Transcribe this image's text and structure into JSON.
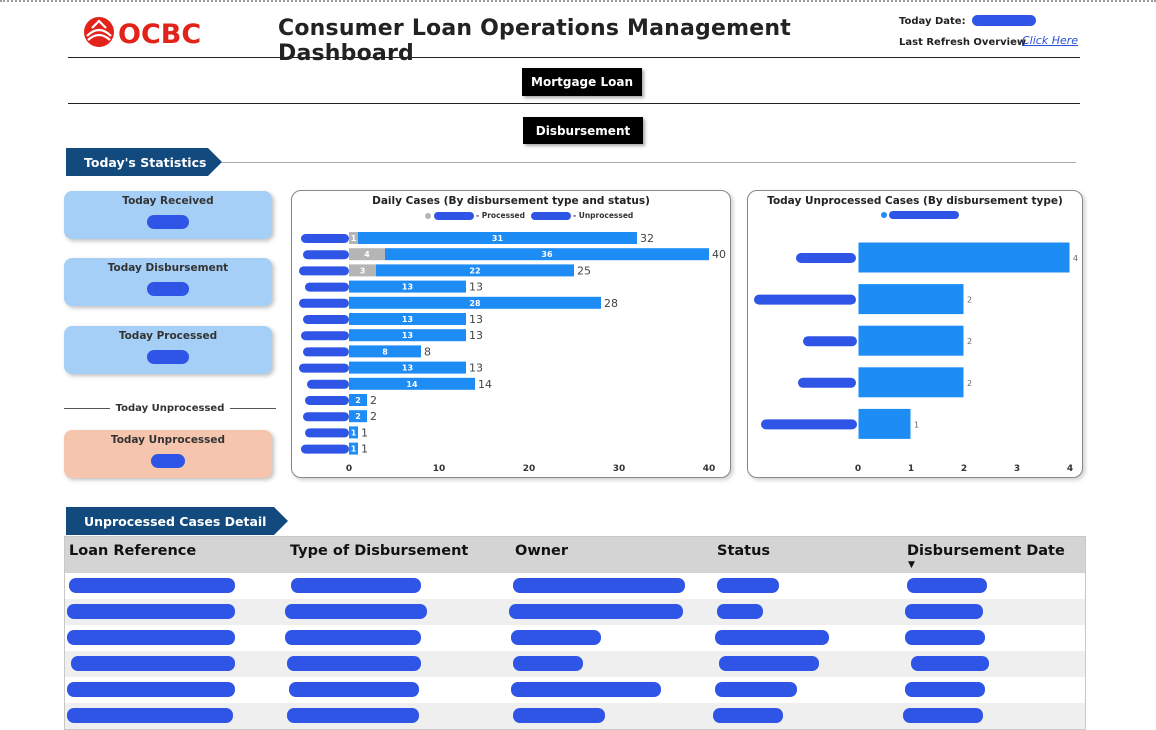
{
  "header": {
    "logo_text": "OCBC",
    "title": "Consumer Loan Operations Management Dashboard",
    "today_date_label": "Today Date:",
    "last_refresh_label": "Last Refresh Overview",
    "click_here_label": "Click Here"
  },
  "nav": {
    "mortgage_button": "Mortgage Loan",
    "disbursement_button": "Disbursement"
  },
  "stats_section": {
    "title": "Today's Statistics",
    "cards": [
      {
        "title": "Today Received"
      },
      {
        "title": "Today Disbursement"
      },
      {
        "title": "Today Processed"
      }
    ],
    "unprocessed_divider": "Today Unprocessed",
    "unprocessed_card": {
      "title": "Today Unprocessed"
    }
  },
  "colors": {
    "processed": "#b5b5b5",
    "unprocessed": "#1e8cf5",
    "banner": "#124a7d",
    "card_blue": "#a5cff7",
    "card_salmon": "#f5c5ae",
    "redaction": "#2f55e6"
  },
  "chart_data": [
    {
      "type": "bar",
      "orientation": "horizontal",
      "stacked": true,
      "title": "Daily Cases (By disbursement type and status)",
      "legend": {
        "placement": "top",
        "processed_label": "Processed",
        "unprocessed_label": "Unprocessed"
      },
      "xlim": [
        0,
        40
      ],
      "xticks": [
        "0",
        "10",
        "20",
        "30",
        "40"
      ],
      "series": [
        {
          "name": "Processed",
          "values": [
            1,
            4,
            3,
            0,
            0,
            0,
            0,
            0,
            0,
            0,
            0,
            0,
            0,
            0
          ]
        },
        {
          "name": "Unprocessed",
          "values": [
            31,
            36,
            22,
            13,
            28,
            13,
            13,
            8,
            13,
            14,
            2,
            2,
            1,
            1
          ]
        }
      ],
      "totals": [
        32,
        40,
        25,
        13,
        28,
        13,
        13,
        8,
        13,
        14,
        2,
        2,
        1,
        1
      ],
      "grid": false
    },
    {
      "type": "bar",
      "orientation": "horizontal",
      "title": "Today Unprocessed Cases (By disbursement type)",
      "xlim": [
        0,
        4
      ],
      "xticks": [
        "0",
        "1",
        "2",
        "3",
        "4"
      ],
      "values": [
        4,
        2,
        2,
        2,
        1
      ],
      "grid": false
    }
  ],
  "table": {
    "title": "Unprocessed Cases Detail",
    "columns": [
      "Loan Reference",
      "Type of Disbursement",
      "Owner",
      "Status",
      "Disbursement Date"
    ],
    "sort_indicator": "▼",
    "row_count": 6
  }
}
